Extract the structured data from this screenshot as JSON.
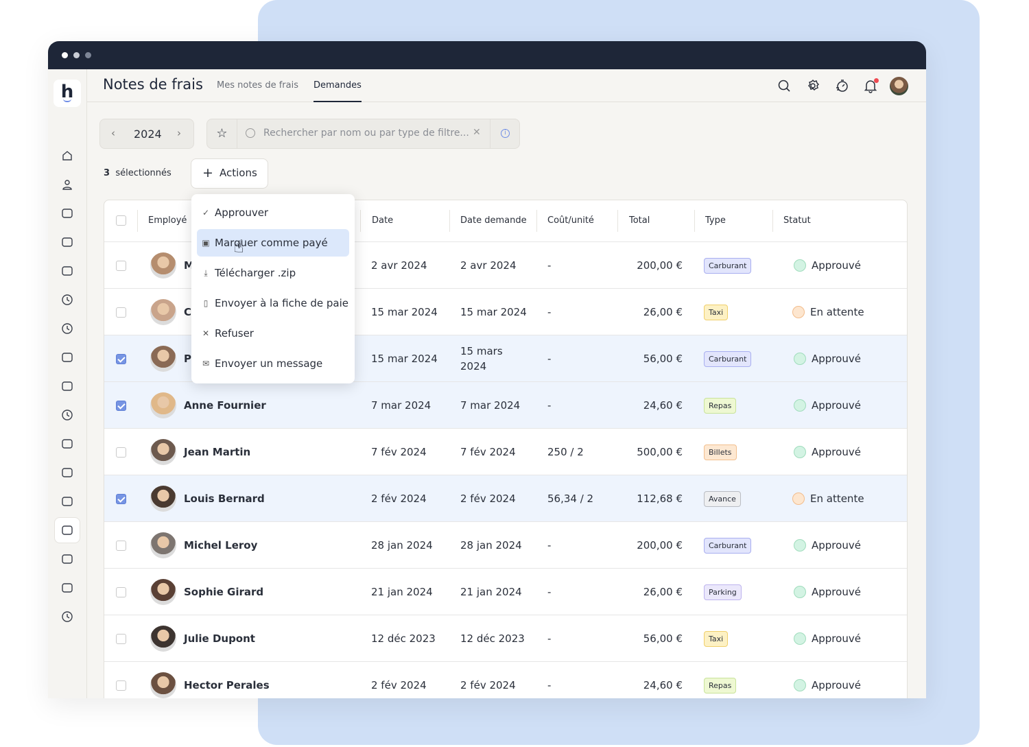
{
  "app": {
    "title": "Notes de frais",
    "tabs": [
      {
        "label": "Mes notes de frais"
      },
      {
        "label": "Demandes",
        "active": true
      }
    ]
  },
  "header_icons": [
    "search-icon",
    "gear-icon",
    "stopwatch-icon",
    "bell-icon",
    "user-avatar"
  ],
  "sidebar_icons": [
    "home-icon",
    "user-icon",
    "users-icon",
    "folder-icon",
    "calendar-icon",
    "clock-icon",
    "timer-icon",
    "checkbox-icon",
    "chart-icon",
    "target-icon",
    "chat-icon",
    "graduation-icon",
    "workflow-icon",
    "expense-icon",
    "alert-icon",
    "user-add-icon",
    "pie-icon"
  ],
  "filters": {
    "year": "2024",
    "search_placeholder": "Rechercher par nom ou par type de filtre..."
  },
  "selection": {
    "count": "3",
    "label": "sélectionnés",
    "actions_label": "Actions"
  },
  "menu": {
    "items": [
      {
        "icon": "check-icon",
        "label": "Approuver"
      },
      {
        "icon": "money-icon",
        "label": "Marquer comme payé",
        "highlighted": true
      },
      {
        "icon": "download-icon",
        "label": "Télécharger .zip"
      },
      {
        "icon": "payslip-icon",
        "label": "Envoyer à la fiche de paie"
      },
      {
        "icon": "close-icon",
        "label": "Refuser"
      },
      {
        "icon": "mail-icon",
        "label": "Envoyer un message"
      }
    ]
  },
  "table": {
    "columns": [
      "Employé",
      "Date",
      "Date demande",
      "Coût/unité",
      "Total",
      "Type",
      "Statut"
    ],
    "rows": [
      {
        "name": "M",
        "date": "2 avr 2024",
        "requested": "2 avr 2024",
        "unit": "-",
        "total": "200,00 €",
        "type": "Carburant",
        "status": "Approuvé",
        "selected": false
      },
      {
        "name": "C",
        "date": "15 mar 2024",
        "requested": "15 mar 2024",
        "unit": "-",
        "total": "26,00 €",
        "type": "Taxi",
        "status": "En attente",
        "selected": false
      },
      {
        "name": "P",
        "date": "15 mar 2024",
        "requested": "15 mars 2024",
        "unit": "-",
        "total": "56,00 €",
        "type": "Carburant",
        "status": "Approuvé",
        "selected": true
      },
      {
        "name": "Anne Fournier",
        "date": "7 mar 2024",
        "requested": "7 mar 2024",
        "unit": "-",
        "total": "24,60 €",
        "type": "Repas",
        "status": "Approuvé",
        "selected": true
      },
      {
        "name": "Jean Martin",
        "date": "7 fév 2024",
        "requested": "7 fév 2024",
        "unit": "250 / 2",
        "total": "500,00 €",
        "type": "Billets",
        "status": "Approuvé",
        "selected": false
      },
      {
        "name": "Louis Bernard",
        "date": "2 fév 2024",
        "requested": "2 fév 2024",
        "unit": "56,34 / 2",
        "total": "112,68 €",
        "type": "Avance",
        "status": "En attente",
        "selected": true
      },
      {
        "name": "Michel Leroy",
        "date": "28 jan 2024",
        "requested": "28 jan 2024",
        "unit": "-",
        "total": "200,00 €",
        "type": "Carburant",
        "status": "Approuvé",
        "selected": false
      },
      {
        "name": "Sophie Girard",
        "date": "21 jan 2024",
        "requested": "21 jan 2024",
        "unit": "-",
        "total": "26,00 €",
        "type": "Parking",
        "status": "Approuvé",
        "selected": false
      },
      {
        "name": "Julie Dupont",
        "date": "12 déc 2023",
        "requested": "12 déc 2023",
        "unit": "-",
        "total": "56,00 €",
        "type": "Taxi",
        "status": "Approuvé",
        "selected": false
      },
      {
        "name": "Hector Perales",
        "date": "2 fév 2024",
        "requested": "2 fév 2024",
        "unit": "-",
        "total": "24,60 €",
        "type": "Repas",
        "status": "Approuvé",
        "selected": false
      }
    ]
  },
  "colors": {
    "tags": {
      "Carburant": [
        "#e2e5fc",
        "#a8aef0"
      ],
      "Taxi": [
        "#fdf1c4",
        "#f0cf6a"
      ],
      "Repas": [
        "#eef8d2",
        "#c8e39a"
      ],
      "Billets": [
        "#fde8d2",
        "#f2bf8e"
      ],
      "Avance": [
        "#eeeff1",
        "#b9bcc2"
      ],
      "Parking": [
        "#ebe8fb",
        "#bdb3ee"
      ]
    },
    "status": {
      "Approuvé": [
        "#d3f3e3",
        "#9fdcbc"
      ],
      "En attente": [
        "#fde6cf",
        "#f2bc8b"
      ]
    }
  }
}
